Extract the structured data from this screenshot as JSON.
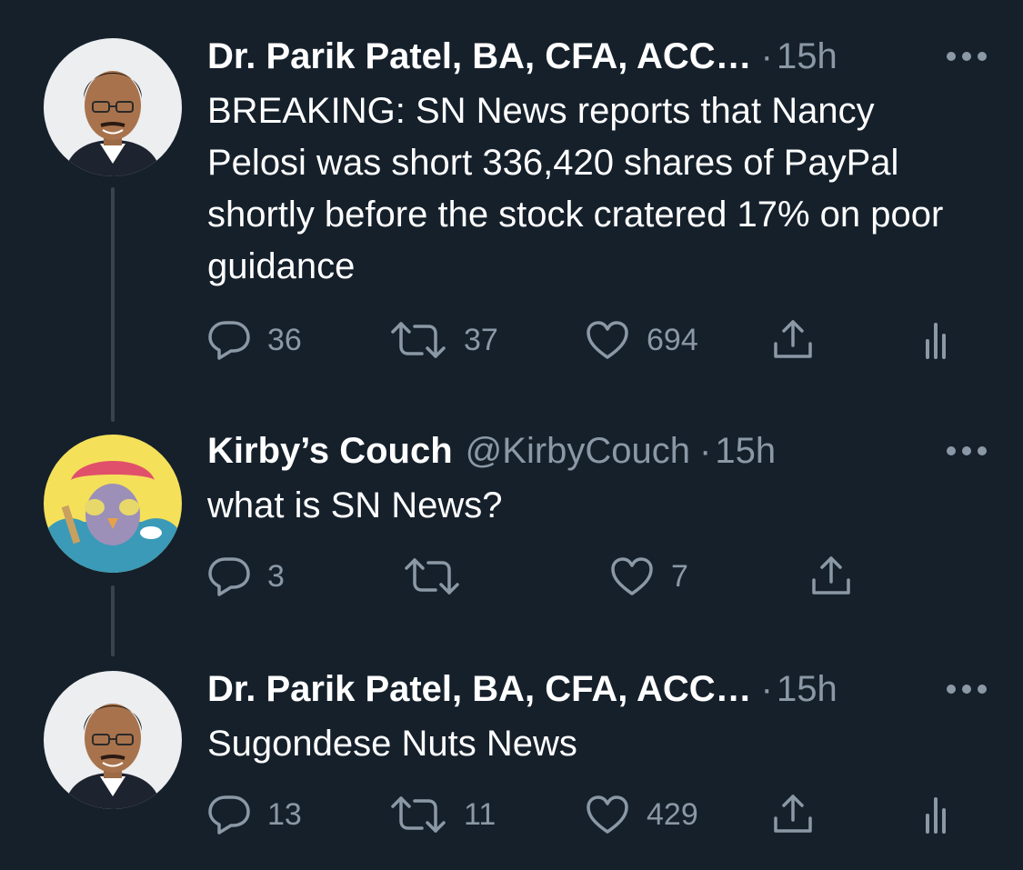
{
  "tweets": [
    {
      "name": "Dr. Parik Patel, BA, CFA, ACC…",
      "handle": "",
      "time": "15h",
      "text": "BREAKING: SN News reports that Nancy Pelosi was short 336,420 shares of PayPal shortly before the stock cratered 17% on poor guidance",
      "replies": "36",
      "retweets": "37",
      "likes": "694"
    },
    {
      "name": "Kirby’s Couch",
      "handle": "@KirbyCouch",
      "time": "15h",
      "text": "what is SN News?",
      "replies": "3",
      "retweets": "",
      "likes": "7"
    },
    {
      "name": "Dr. Parik Patel, BA, CFA, ACC…",
      "handle": "",
      "time": "15h",
      "text": "Sugondese Nuts News",
      "replies": "13",
      "retweets": "11",
      "likes": "429"
    }
  ],
  "separator": "·",
  "icons": {
    "reply": "reply-icon",
    "retweet": "retweet-icon",
    "like": "heart-icon",
    "share": "share-icon",
    "analytics": "analytics-icon",
    "more": "more-icon"
  },
  "colors": {
    "background": "#15202b",
    "text": "#ffffff",
    "secondary": "#8b98a5",
    "thread_line": "#38444d"
  }
}
